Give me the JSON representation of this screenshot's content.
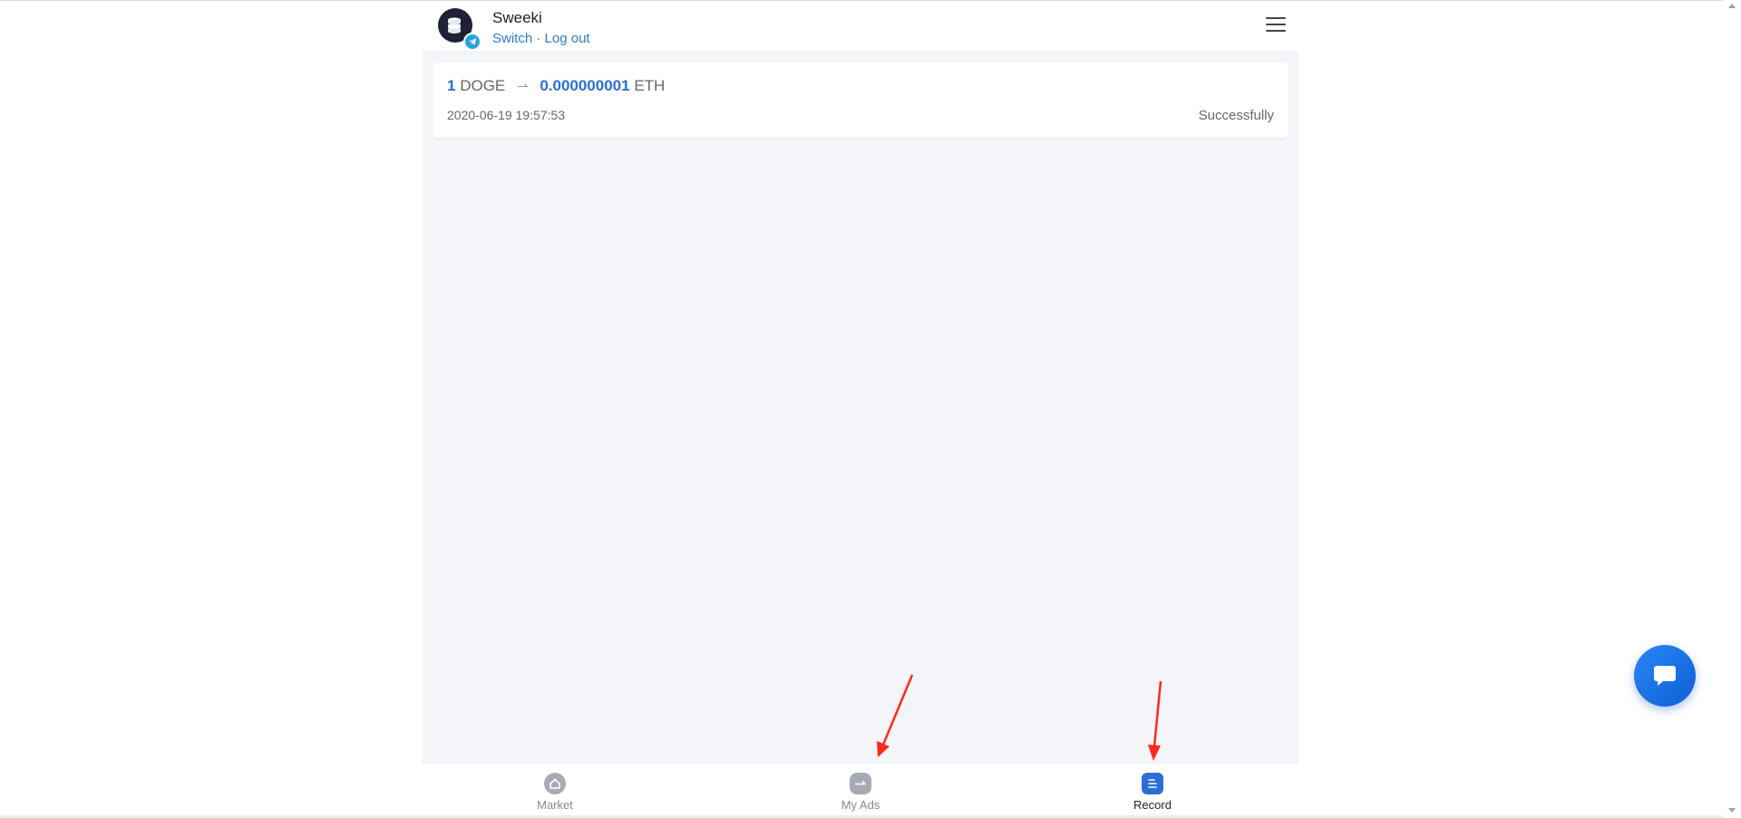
{
  "header": {
    "username": "Sweeki",
    "switch_label": "Switch",
    "separator": " · ",
    "logout_label": "Log out"
  },
  "records": [
    {
      "from_amount": "1",
      "from_coin": "DOGE",
      "arrow": "⇀",
      "to_amount": "0.000000001",
      "to_coin": "ETH",
      "time": "2020-06-19 19:57:53",
      "status": "Successfully"
    }
  ],
  "bottom_nav": {
    "items": [
      {
        "label": "Market",
        "icon": "home-icon",
        "active": false
      },
      {
        "label": "My Ads",
        "icon": "swap-icon",
        "active": false
      },
      {
        "label": "Record",
        "icon": "list-icon",
        "active": true
      }
    ]
  },
  "colors": {
    "accent": "#2b6fd6",
    "link": "#2b79d6",
    "background": "#f4f5f9",
    "annotation_arrow": "#ff2a1a"
  }
}
